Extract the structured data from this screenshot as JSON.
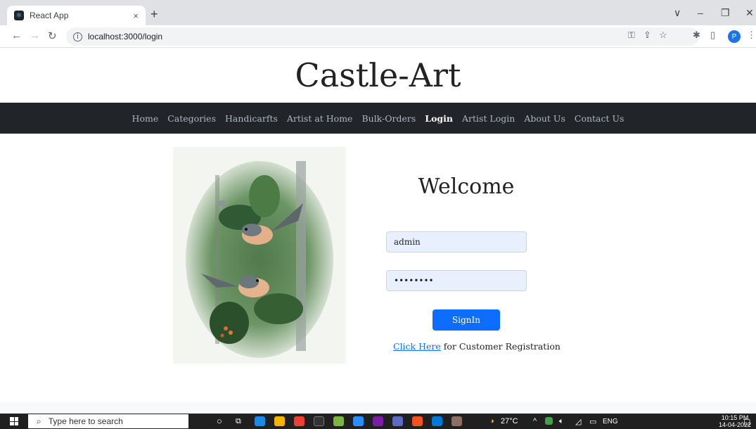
{
  "browser": {
    "tab_title": "React App",
    "tab_close": "×",
    "new_tab": "+",
    "url": "localhost:3000/login",
    "window_controls": [
      "∨",
      "–",
      "❐",
      "✕"
    ],
    "profile_initial": "P"
  },
  "site": {
    "title": "Castle-Art",
    "nav": [
      {
        "label": "Home",
        "active": false
      },
      {
        "label": "Categories",
        "active": false
      },
      {
        "label": "Handicarfts",
        "active": false
      },
      {
        "label": "Artist at Home",
        "active": false
      },
      {
        "label": "Bulk-Orders",
        "active": false
      },
      {
        "label": "Login",
        "active": true
      },
      {
        "label": "Artist Login",
        "active": false
      },
      {
        "label": "About Us",
        "active": false
      },
      {
        "label": "Contact Us",
        "active": false
      }
    ]
  },
  "login": {
    "heading": "Welcome",
    "username_value": "admin",
    "password_value": "admin123",
    "submit_label": "SignIn",
    "register_link": "Click Here",
    "register_text": " for Customer Registration"
  },
  "taskbar": {
    "search_placeholder": "Type here to search",
    "weather": "27°C",
    "language": "ENG",
    "time": "10:15 PM",
    "date": "14-04-2022"
  },
  "colors": {
    "navbar_bg": "#212529",
    "primary": "#0d6efd",
    "input_bg": "#e8f0fe"
  }
}
